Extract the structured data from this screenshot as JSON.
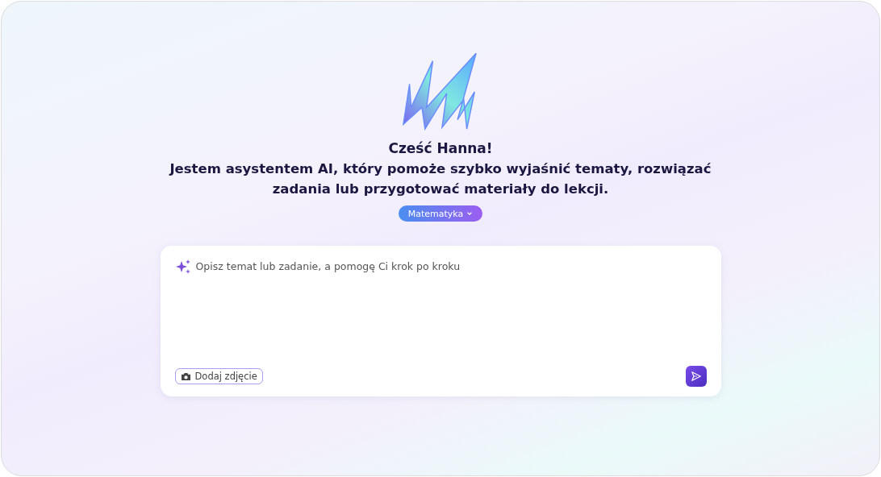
{
  "greeting": "Cześć Hanna!",
  "intro": "Jestem asystentem AI, który pomoże szybko wyjaśnić tematy, rozwiązać zadania lub przygotować materiały do lekcji.",
  "subject_dropdown": {
    "value": "Matematyka"
  },
  "prompt": {
    "placeholder": "Opisz temat lub zadanie, a pomogę Ci krok po kroku"
  },
  "attach_button": {
    "label": "Dodaj zdjęcie"
  }
}
